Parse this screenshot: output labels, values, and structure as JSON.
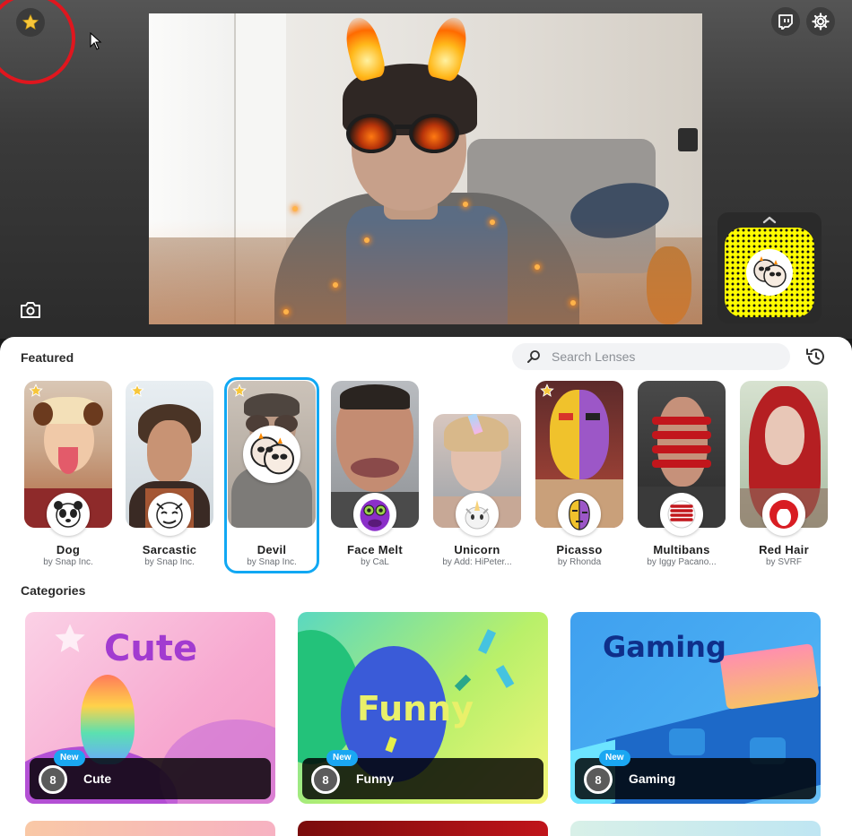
{
  "camera": {
    "favorite_icon": "star-icon",
    "capture_icon": "camera-icon",
    "twitch_icon": "twitch-icon",
    "settings_icon": "gear-icon",
    "expand_icon": "chevron-up-icon"
  },
  "featured": {
    "heading": "Featured",
    "search_placeholder": "Search Lenses",
    "history_icon": "history-icon",
    "lenses": [
      {
        "name": "Dog",
        "author": "by Snap Inc.",
        "favorite": true,
        "selected": false
      },
      {
        "name": "Sarcastic",
        "author": "by Snap Inc.",
        "favorite": true,
        "selected": false
      },
      {
        "name": "Devil",
        "author": "by Snap Inc.",
        "favorite": true,
        "selected": true
      },
      {
        "name": "Face Melt",
        "author": "by CaL",
        "favorite": false,
        "selected": false
      },
      {
        "name": "Unicorn",
        "author": "by Add: HiPeter...",
        "favorite": false,
        "selected": false
      },
      {
        "name": "Picasso",
        "author": "by Rhonda",
        "favorite": true,
        "selected": false
      },
      {
        "name": "Multibans",
        "author": "by Iggy Pacano...",
        "favorite": false,
        "selected": false
      },
      {
        "name": "Red Hair",
        "author": "by SVRF",
        "favorite": false,
        "selected": false
      }
    ]
  },
  "categories": {
    "heading": "Categories",
    "items": [
      {
        "art_title": "Cute",
        "label": "Cute",
        "count": "8",
        "badge": "New"
      },
      {
        "art_title": "Funny",
        "label": "Funny",
        "count": "8",
        "badge": "New"
      },
      {
        "art_title": "Gaming",
        "label": "Gaming",
        "count": "8",
        "badge": "New"
      }
    ]
  },
  "colors": {
    "accent": "#11a8f3",
    "favorite_star": "#f7c63a",
    "annotation_ring": "#e0161e",
    "snapcode": "#fffc00"
  }
}
